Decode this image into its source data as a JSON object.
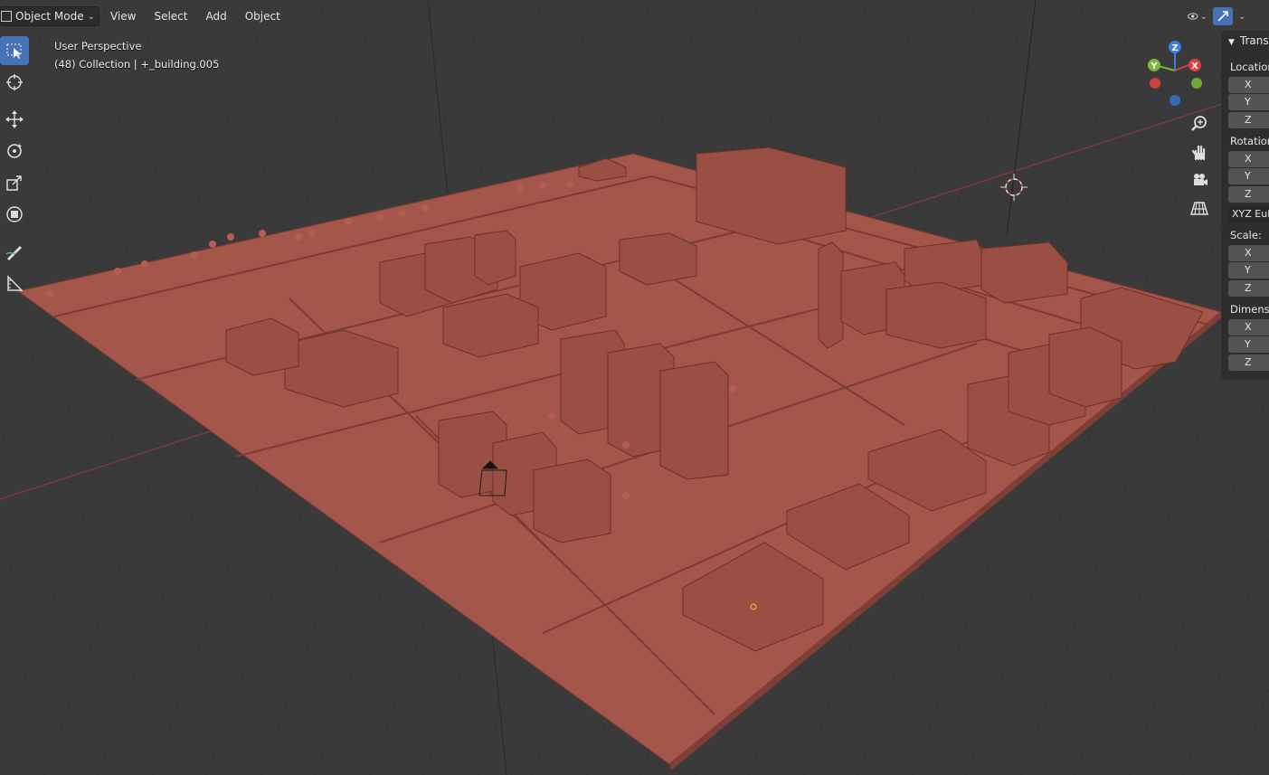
{
  "header": {
    "mode_label": "Object Mode",
    "menu": [
      "View",
      "Select",
      "Add",
      "Object"
    ]
  },
  "viewport_info": {
    "view_name": "User Perspective",
    "collection_line": "(48) Collection | +_building.005"
  },
  "toolbar": {
    "tools": [
      "select-box",
      "cursor",
      "move",
      "rotate",
      "scale",
      "transform",
      "annotate",
      "measure"
    ],
    "active_tool": "select-box"
  },
  "gizmo": {
    "axes": [
      "Z",
      "Y",
      "X"
    ],
    "colors": {
      "x": "#e0403e",
      "y": "#7ab53a",
      "z": "#3a7ee0"
    }
  },
  "nav_buttons": [
    "zoom-icon",
    "hand-pan-icon",
    "camera-icon",
    "grid-perspective-icon"
  ],
  "n_panel": {
    "title": "Transform",
    "location_label": "Location:",
    "rotation_label": "Rotation:",
    "rotation_mode": "XYZ Euler",
    "scale_label": "Scale:",
    "dimensions_label": "Dimensions:",
    "axes": [
      "X",
      "Y",
      "Z"
    ]
  },
  "colors": {
    "model": "#a4564b",
    "grid_bg": "#3a3a3a",
    "accent": "#4772b3"
  }
}
